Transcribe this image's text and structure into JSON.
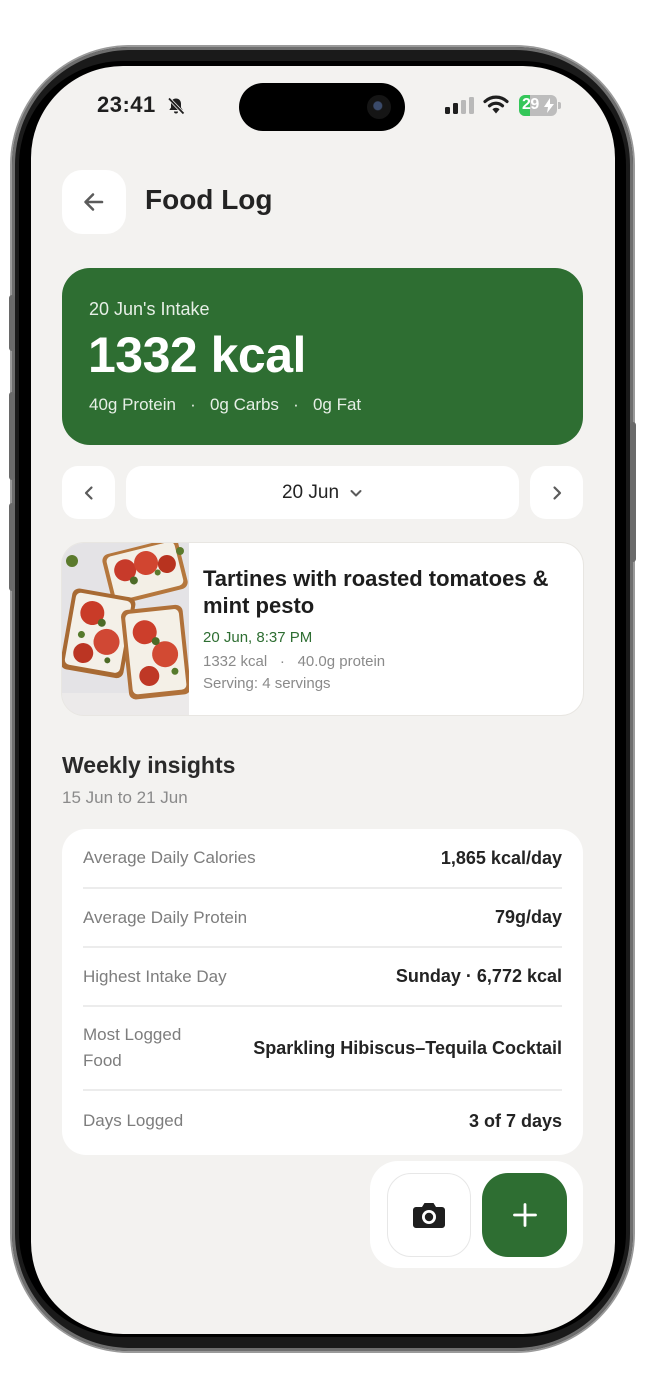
{
  "status_bar": {
    "time": "23:41",
    "battery_level": "29",
    "battery_charge_fraction": 0.29,
    "icons": [
      "bell-slash-icon",
      "cellular-signal-icon",
      "wifi-icon",
      "battery-charging-icon"
    ]
  },
  "header": {
    "back_icon": "arrow-left-icon",
    "title": "Food Log"
  },
  "intake": {
    "label": "20 Jun's Intake",
    "kcal": "1332 kcal",
    "protein": "40g Protein",
    "carbs": "0g Carbs",
    "fat": "0g Fat",
    "separator": "·"
  },
  "date_nav": {
    "prev_icon": "chevron-left-icon",
    "next_icon": "chevron-right-icon",
    "dropdown_icon": "chevron-down-icon",
    "selected_date": "20 Jun"
  },
  "entries": [
    {
      "name": "Tartines with roasted tomatoes & mint pesto",
      "time": "20 Jun, 8:37 PM",
      "kcal": "1332 kcal",
      "separator": "·",
      "protein": "40.0g protein",
      "serving": "Serving: 4 servings"
    }
  ],
  "insights": {
    "title": "Weekly insights",
    "range": "15 Jun to 21 Jun",
    "rows": [
      {
        "label": "Average Daily Calories",
        "value": "1,865 kcal/day"
      },
      {
        "label": "Average Daily Protein",
        "value": "79g/day"
      },
      {
        "label": "Highest Intake Day",
        "value": "Sunday · 6,772 kcal"
      },
      {
        "label": "Most Logged Food",
        "value": "Sparkling Hibiscus–Tequila Cocktail"
      },
      {
        "label": "Days Logged",
        "value": "3 of 7 days"
      }
    ]
  },
  "actions": {
    "camera_icon": "camera-icon",
    "add_icon": "plus-icon"
  },
  "colors": {
    "accent_green": "#2e6e32",
    "background": "#f3f2f0",
    "card": "#ffffff",
    "muted_text": "#8a8a8a"
  }
}
